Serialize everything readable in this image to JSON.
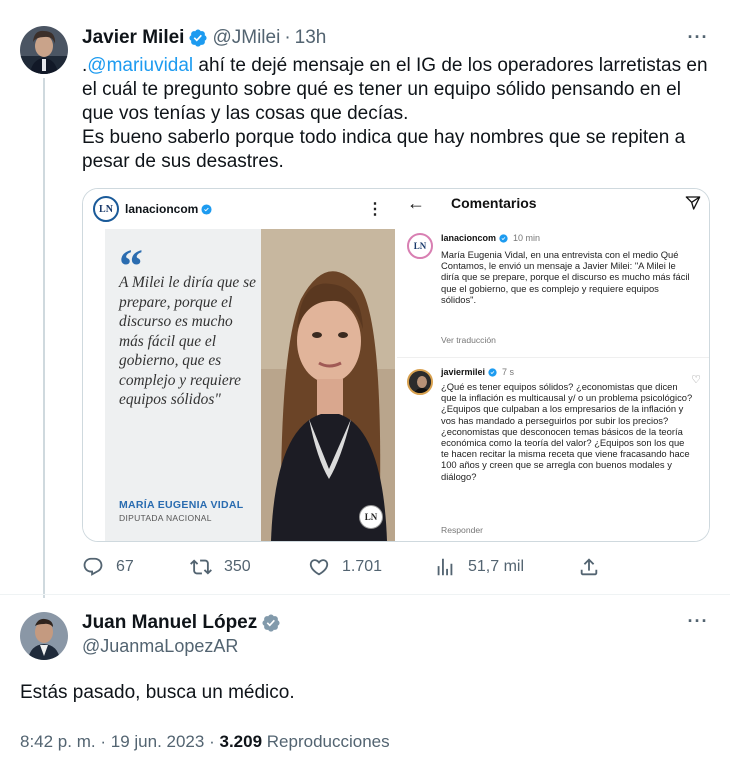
{
  "tweet1": {
    "name": "Javier Milei",
    "handle": "@JMilei",
    "separator": "·",
    "time": "13h",
    "text_prefix": ".",
    "mention": "@mariuvidal",
    "text_line1_rest": " ahí te dejé mensaje en el IG de los operadores larretistas en el cuál te pregunto sobre qué es tener un equipo sólido pensando en el que vos tenías y las cosas que decías.",
    "text_line2": "Es bueno saberlo porque todo indica que hay nombres que se repiten a pesar de sus desastres.",
    "more_label": "···",
    "media": {
      "left": {
        "account": "lanacioncom",
        "logo_text": "LN",
        "menu": "⋮",
        "quote_mark": "“",
        "quote": "A Milei le diría que se prepare, porque el discurso es mucho más fácil que el gobierno, que es complejo y requiere equipos sólidos\"",
        "quote_author": "MARÍA EUGENIA VIDAL",
        "quote_role": "DIPUTADA NACIONAL",
        "badge": "LN"
      },
      "right": {
        "back": "←",
        "title": "Comentarios",
        "c1_user": "lanacioncom",
        "c1_ago": "10 min",
        "c1_avatar": "LN",
        "c1_text": "María Eugenia Vidal, en una entrevista con el medio Qué Contamos, le envió un mensaje a Javier Milei: \"A Milei le diría que se prepare, porque el discurso es mucho más fácil que el gobierno, que es complejo y requiere equipos sólidos\".",
        "c1_sub": "Ver traducción",
        "c2_user": "javiermilei",
        "c2_ago": "7 s",
        "c2_text": "¿Qué es tener equipos sólidos? ¿economistas que dicen que la inflación es multicausal y/ o un problema psicológico? ¿Equipos que culpaban a los empresarios de la inflación y vos has mandado a perseguirlos por subir los precios? ¿economistas que desconocen temas básicos de la teoría económica como la teoría del valor? ¿Equipos son los que te hacen recitar la misma receta que viene fracasando hace 100 años y creen que se arregla con buenos modales y diálogo?",
        "c2_sub": "Responder"
      }
    },
    "actions": {
      "replies": "67",
      "retweets": "350",
      "likes": "1.701",
      "views": "51,7 mil"
    }
  },
  "tweet2": {
    "name": "Juan Manuel López",
    "handle": "@JuanmaLopezAR",
    "more_label": "···",
    "text": "Estás pasado, busca un médico.",
    "time": "8:42 p. m.",
    "separator": "·",
    "date": "19 jun. 2023",
    "views_count": "3.209",
    "views_label": "Reproducciones"
  },
  "colors": {
    "accent": "#1d9bf0",
    "secondary_text": "#536471",
    "verified_gray": "#829aab"
  }
}
